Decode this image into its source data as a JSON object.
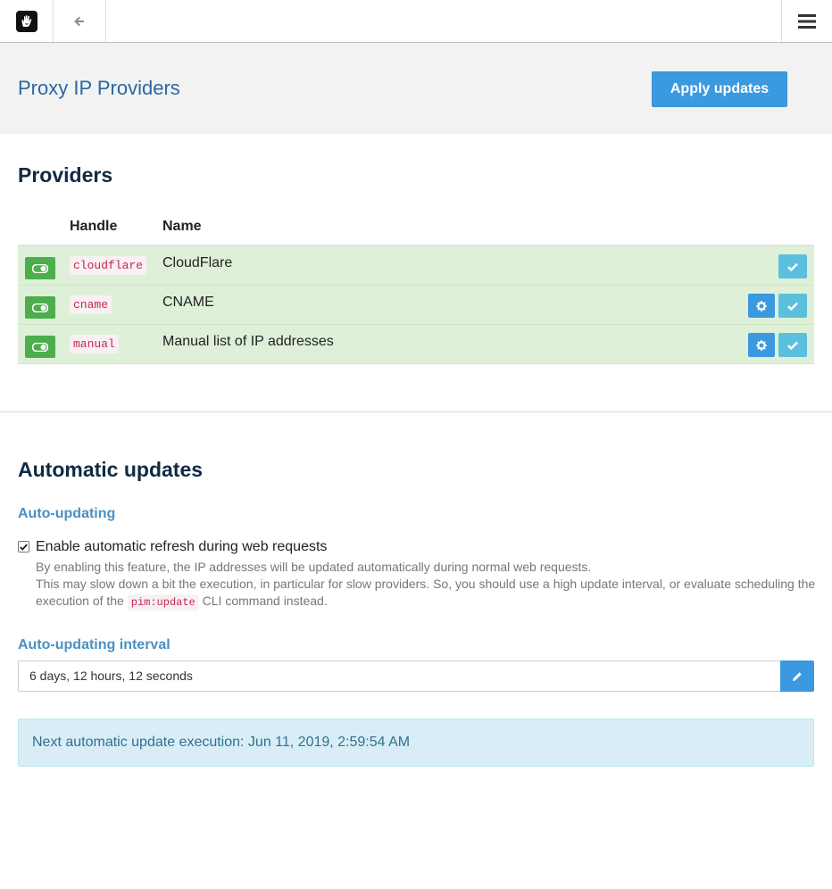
{
  "header": {
    "title": "Proxy IP Providers",
    "apply_label": "Apply updates"
  },
  "providers": {
    "heading": "Providers",
    "columns": [
      "Handle",
      "Name"
    ],
    "rows": [
      {
        "handle": "cloudflare",
        "name": "CloudFlare",
        "has_settings": false
      },
      {
        "handle": "cname",
        "name": "CNAME",
        "has_settings": true
      },
      {
        "handle": "manual",
        "name": "Manual list of IP addresses",
        "has_settings": true
      }
    ]
  },
  "auto": {
    "heading": "Automatic updates",
    "auto_updating_label": "Auto-updating",
    "checkbox_label": "Enable automatic refresh during web requests",
    "checkbox_checked": true,
    "help_line1": "By enabling this feature, the IP addresses will be updated automatically during normal web requests.",
    "help_line2_pre": "This may slow down a bit the execution, in particular for slow providers. So, you should use a high update interval, or evaluate scheduling the execution of the",
    "help_code": "pim:update",
    "help_line2_post": "CLI command instead.",
    "interval_label": "Auto-updating interval",
    "interval_value": "6 days, 12 hours, 12 seconds",
    "next_execution": "Next automatic update execution: Jun 11, 2019, 2:59:54 AM"
  },
  "icons": {
    "logo": "concrete5-hand-logo-icon",
    "back": "arrow-left-icon",
    "menu": "hamburger-menu-icon",
    "toggle": "toggle-on-icon",
    "settings": "gear-icon",
    "check": "check-icon",
    "edit": "pencil-icon"
  },
  "colors": {
    "primary": "#3b99e0",
    "success": "#4cae4c",
    "info": "#5bc0de",
    "row_bg": "#dff0d8",
    "title": "#2a67a3",
    "alert_bg": "#d9edf7",
    "alert_text": "#31708f"
  }
}
